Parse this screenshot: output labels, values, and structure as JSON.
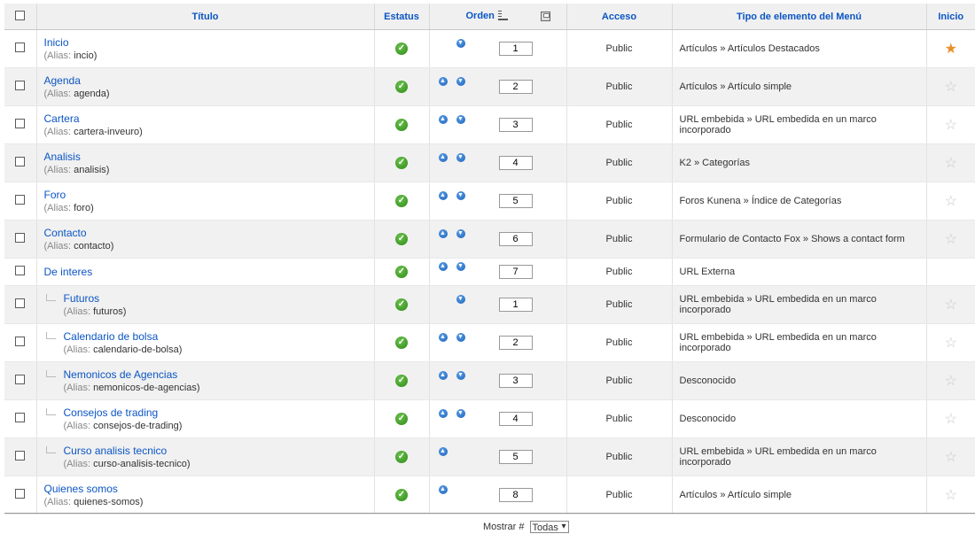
{
  "header": {
    "titulo": "Título",
    "estatus": "Estatus",
    "orden": "Orden",
    "acceso": "Acceso",
    "tipo": "Tipo de elemento del Menú",
    "inicio": "Inicio"
  },
  "rows": [
    {
      "title": "Inicio",
      "alias_label": "(Alias:",
      "alias": "incio)",
      "order": "1",
      "access": "Public",
      "type": "Artículos » Artículos Destacados",
      "up": false,
      "down": true,
      "child": false,
      "star": "on"
    },
    {
      "title": "Agenda",
      "alias_label": "(Alias:",
      "alias": "agenda)",
      "order": "2",
      "access": "Public",
      "type": "Artículos » Artículo simple",
      "up": true,
      "down": true,
      "child": false,
      "star": "off"
    },
    {
      "title": "Cartera",
      "alias_label": "(Alias:",
      "alias": "cartera-inveuro)",
      "order": "3",
      "access": "Public",
      "type": "URL embebida » URL embedida en un marco incorporado",
      "up": true,
      "down": true,
      "child": false,
      "star": "off"
    },
    {
      "title": "Analisis",
      "alias_label": "(Alias:",
      "alias": "analisis)",
      "order": "4",
      "access": "Public",
      "type": "K2 » Categorías",
      "up": true,
      "down": true,
      "child": false,
      "star": "off"
    },
    {
      "title": "Foro",
      "alias_label": "(Alias:",
      "alias": "foro)",
      "order": "5",
      "access": "Public",
      "type": "Foros Kunena » Índice de Categorías",
      "up": true,
      "down": true,
      "child": false,
      "star": "off"
    },
    {
      "title": "Contacto",
      "alias_label": "(Alias:",
      "alias": "contacto)",
      "order": "6",
      "access": "Public",
      "type": "Formulario de Contacto Fox » Shows a contact form",
      "up": true,
      "down": true,
      "child": false,
      "star": "off"
    },
    {
      "title": "De interes",
      "alias_label": "",
      "alias": "",
      "order": "7",
      "access": "Public",
      "type": "URL Externa",
      "up": true,
      "down": true,
      "child": false,
      "star": "none"
    },
    {
      "title": "Futuros",
      "alias_label": "(Alias:",
      "alias": "futuros)",
      "order": "1",
      "access": "Public",
      "type": "URL embebida » URL embedida en un marco incorporado",
      "up": false,
      "down": true,
      "child": true,
      "star": "off"
    },
    {
      "title": "Calendario de bolsa",
      "alias_label": "(Alias:",
      "alias": "calendario-de-bolsa)",
      "order": "2",
      "access": "Public",
      "type": "URL embebida » URL embedida en un marco incorporado",
      "up": true,
      "down": true,
      "child": true,
      "star": "off"
    },
    {
      "title": "Nemonicos de Agencias",
      "alias_label": "(Alias:",
      "alias": "nemonicos-de-agencias)",
      "order": "3",
      "access": "Public",
      "type": "Desconocido",
      "up": true,
      "down": true,
      "child": true,
      "star": "off"
    },
    {
      "title": "Consejos de trading",
      "alias_label": "(Alias:",
      "alias": "consejos-de-trading)",
      "order": "4",
      "access": "Public",
      "type": "Desconocido",
      "up": true,
      "down": true,
      "child": true,
      "star": "off"
    },
    {
      "title": "Curso analisis tecnico",
      "alias_label": "(Alias:",
      "alias": "curso-analisis-tecnico)",
      "order": "5",
      "access": "Public",
      "type": "URL embebida » URL embedida en un marco incorporado",
      "up": true,
      "down": false,
      "child": true,
      "star": "off"
    },
    {
      "title": "Quienes somos",
      "alias_label": "(Alias:",
      "alias": "quienes-somos)",
      "order": "8",
      "access": "Public",
      "type": "Artículos » Artículo simple",
      "up": true,
      "down": false,
      "child": false,
      "star": "off"
    }
  ],
  "footer": {
    "display_label": "Mostrar #",
    "display_value": "Todas"
  },
  "icons": {
    "status": "published-check-icon",
    "up": "move-up-arrow-icon",
    "down": "move-down-arrow-icon",
    "home": "home-star-icon",
    "save_order": "save-order-icon"
  },
  "colors": {
    "link": "#0b55c4",
    "check": "#3a9a1e",
    "star_on": "#e8902a"
  }
}
